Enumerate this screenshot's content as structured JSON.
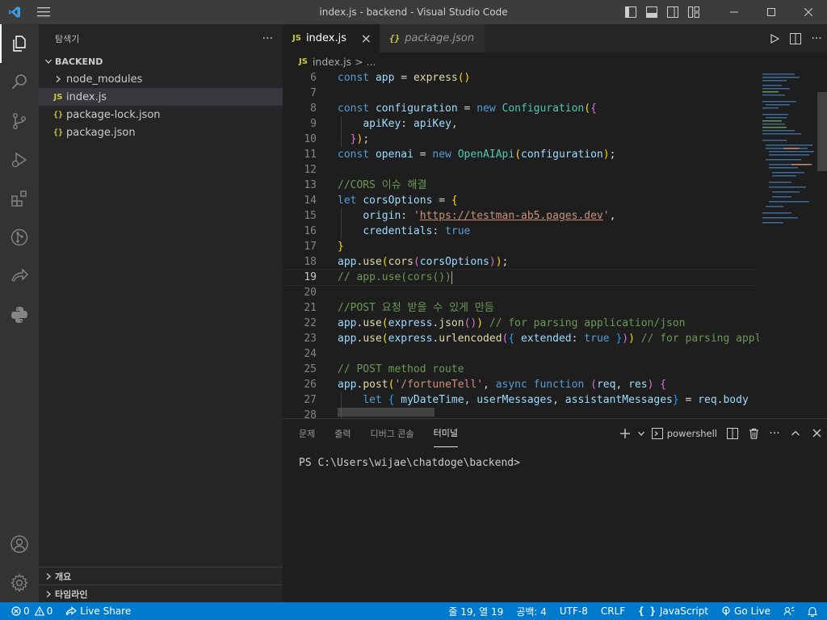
{
  "window": {
    "title": "index.js - backend - Visual Studio Code"
  },
  "sidebar": {
    "header": "탐색기",
    "more": "···",
    "section": "BACKEND",
    "items": [
      {
        "label": "node_modules",
        "type": "folder"
      },
      {
        "label": "index.js",
        "type": "js",
        "badge": "JS"
      },
      {
        "label": "package-lock.json",
        "type": "json",
        "badge": "{}"
      },
      {
        "label": "package.json",
        "type": "json",
        "badge": "{}"
      }
    ],
    "outline": "개요",
    "timeline": "타임라인"
  },
  "editor": {
    "tabs": [
      {
        "label": "index.js",
        "badge": "JS",
        "close": "×"
      },
      {
        "label": "package.json",
        "badge": "{}"
      }
    ],
    "breadcrumb": {
      "badge": "JS",
      "file": "index.js",
      "sep": ">",
      "rest": "..."
    },
    "line_numbers": [
      6,
      7,
      8,
      9,
      10,
      11,
      12,
      13,
      14,
      15,
      16,
      17,
      18,
      19,
      20,
      21,
      22,
      23,
      24,
      25,
      26,
      27,
      28
    ],
    "current_line": 19
  },
  "panel": {
    "tabs": [
      "문제",
      "출력",
      "디버그 콘솔",
      "터미널"
    ],
    "active_tab": "터미널",
    "shell": "powershell",
    "prompt": "PS C:\\Users\\wijae\\chatdoge\\backend>"
  },
  "statusbar": {
    "errors": "0",
    "warnings": "0",
    "live_share": "Live Share",
    "position": "줄 19, 열 19",
    "spaces": "공백: 4",
    "encoding": "UTF-8",
    "eol": "CRLF",
    "language_badge": "{ }",
    "language": "JavaScript",
    "go_live": "Go Live"
  }
}
